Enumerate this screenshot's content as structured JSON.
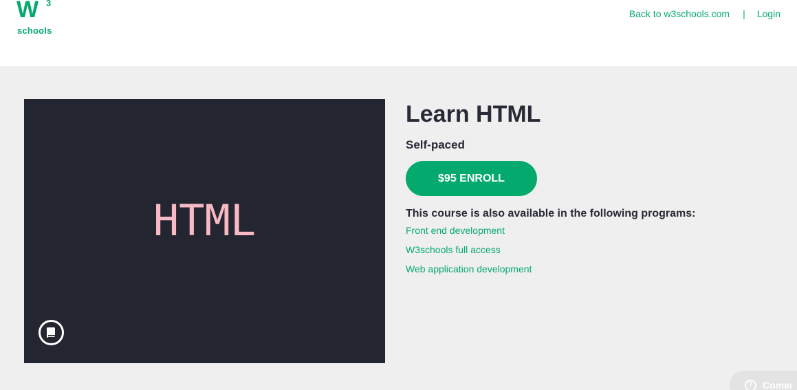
{
  "header": {
    "logo": {
      "mark": "W",
      "superscript": "3",
      "wordmark": "schools"
    },
    "nav": {
      "back_link": "Back to w3schools.com",
      "separator": "|",
      "login": "Login"
    }
  },
  "course": {
    "image_text": "HTML",
    "title": "Learn HTML",
    "pace": "Self-paced",
    "enroll_label": "$95 ENROLL",
    "programs_heading": "This course is also available in the following programs:",
    "programs": [
      "Front end development",
      "W3schools full access",
      "Web application development"
    ]
  },
  "widget": {
    "comment_label": "Comer",
    "icon": "question-icon"
  },
  "colors": {
    "brand_green": "#04aa6d",
    "dark_text": "#282a35",
    "image_background": "#232531",
    "image_text": "#f7b9c4",
    "page_background": "#efefef"
  }
}
